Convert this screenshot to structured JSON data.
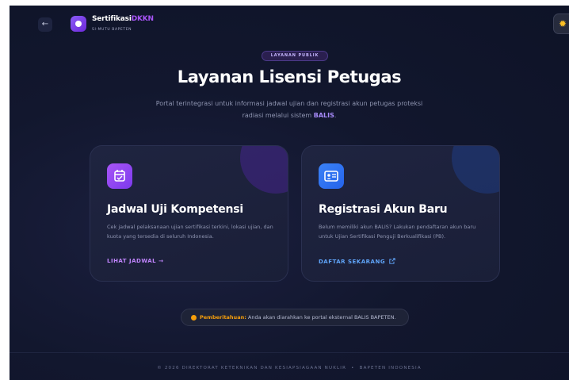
{
  "header": {
    "back_icon": "arrow-left-icon",
    "brand_title": "Sertifikasi",
    "brand_accent": "DKKN",
    "brand_sub": "SI-MUTU BAPETEN",
    "theme_icon": "sun-icon"
  },
  "hero": {
    "badge": "LAYANAN PUBLIK",
    "title": "Layanan Lisensi Petugas",
    "description_lead": "Portal terintegrasi untuk informasi jadwal ujian dan registrasi akun petugas proteksi radiasi melalui sistem ",
    "description_highlight": "BALIS",
    "description_tail": "."
  },
  "cards": [
    {
      "icon": "calendar-check-icon",
      "title": "Jadwal Uji Kompetensi",
      "description": "Cek jadwal pelaksanaan ujian sertifikasi terkini, lokasi ujian, dan kuota yang tersedia di seluruh Indonesia.",
      "link_label": "LIHAT JADWAL",
      "link_icon": "arrow-right-icon"
    },
    {
      "icon": "id-card-icon",
      "title": "Registrasi Akun Baru",
      "description": "Belum memiliki akun BALIS? Lakukan pendaftaran akun baru untuk Ujian Sertifikasi Penguji Berkualifikasi (PB).",
      "link_label": "DAFTAR SEKARANG",
      "link_icon": "external-link-icon"
    }
  ],
  "notice": {
    "icon": "info-icon",
    "label": "Pemberitahuan:",
    "text": "Anda akan diarahkan ke portal eksternal BALIS BAPETEN."
  },
  "footer": {
    "left": "© 2026 DIREKTORAT KETEKNIKAN DAN KESIAPSIAGAAN NUKLIR",
    "separator": "•",
    "right": "BAPETEN INDONESIA"
  },
  "colors": {
    "background": "#12172e",
    "accent_purple": "#a855f7",
    "accent_blue": "#3b82f6",
    "warning": "#f59e0b"
  }
}
